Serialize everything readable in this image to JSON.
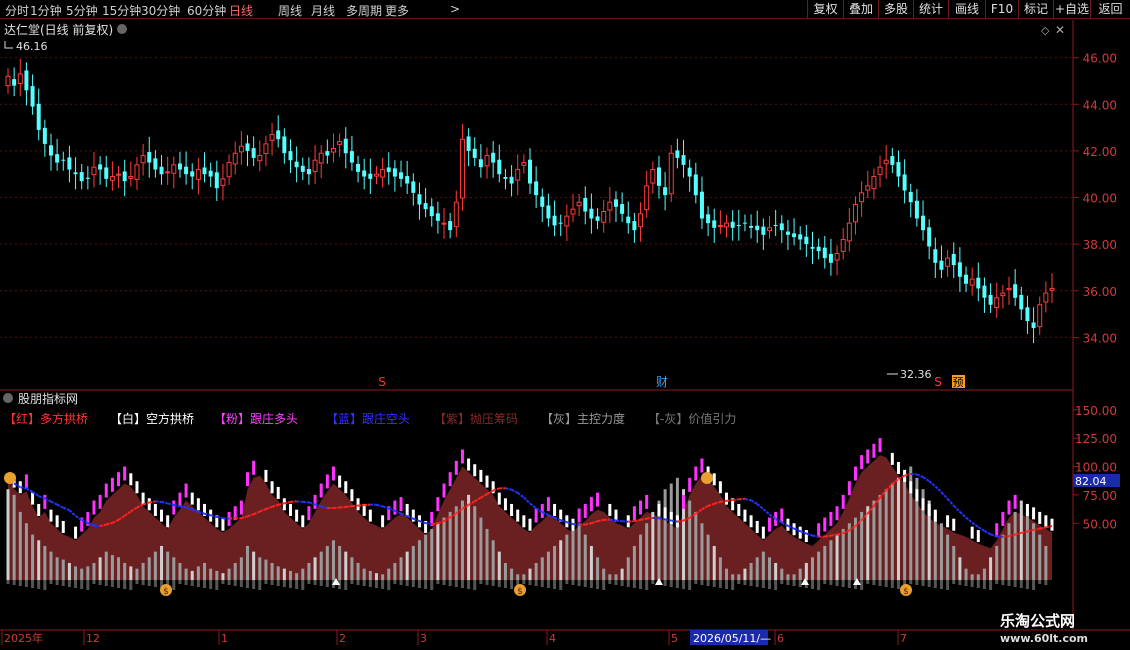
{
  "toolbar": {
    "periods": [
      "分时",
      "1分钟",
      "5分钟",
      "15分钟",
      "30分钟",
      "60分钟",
      "日线",
      "周线",
      "月线",
      "多周期",
      "更多"
    ],
    "active": "日线",
    "more_arrow": ">",
    "right_buttons": [
      "复权",
      "叠加",
      "多股",
      "统计",
      "画线",
      "F10",
      "标记",
      "+自选",
      "返回"
    ]
  },
  "main": {
    "title": "达仁堂(日线 前复权)",
    "high_label": "46.16",
    "low_label": "32.36",
    "markers": [
      {
        "text": "S",
        "color": "#ff3333"
      },
      {
        "text": "财",
        "color": "#3aa0ff"
      },
      {
        "text": "S",
        "color": "#ff3333"
      },
      {
        "text": "预",
        "color": "#ffbb33"
      }
    ]
  },
  "indicator": {
    "title": "股朋指标网",
    "current_value": "82.04",
    "legend": [
      {
        "text": "【红】多方拱桥",
        "color": "#ff3333"
      },
      {
        "text": "【白】空方拱桥",
        "color": "#ffffff"
      },
      {
        "text": "【粉】跟庄多头",
        "color": "#ff44ff"
      },
      {
        "text": "【蓝】跟庄空头",
        "color": "#3333ff"
      },
      {
        "text": "【紫】抛压筹码",
        "color": "#8a2a2a"
      },
      {
        "text": "【灰】主控力度",
        "color": "#9a9a9a"
      },
      {
        "text": "【-灰】价值引力",
        "color": "#777777"
      }
    ]
  },
  "timeline": {
    "labels": [
      "2025年",
      "12",
      "1",
      "2",
      "3",
      "4",
      "5",
      "6",
      "7"
    ],
    "cursor_date": "2026/05/11/—"
  },
  "watermark": {
    "text": "乐淘公式网",
    "url": "www.60lt.com"
  },
  "chart_data": [
    {
      "type": "candlestick",
      "title": "达仁堂(日线 前复权)",
      "yticks": [
        34.0,
        36.0,
        38.0,
        40.0,
        42.0,
        44.0,
        46.0
      ],
      "ylim": [
        32.0,
        46.8
      ],
      "grid": true,
      "n": 170,
      "close": [
        45.2,
        44.8,
        45.3,
        44.6,
        43.9,
        42.9,
        42.3,
        41.8,
        41.5,
        41.6,
        41.2,
        41.0,
        40.7,
        40.8,
        41.3,
        41.2,
        40.8,
        40.9,
        41.0,
        40.7,
        40.9,
        41.4,
        41.8,
        41.5,
        41.2,
        41.0,
        41.1,
        41.4,
        41.2,
        41.0,
        40.9,
        41.2,
        41.0,
        40.9,
        40.4,
        40.8,
        41.5,
        41.9,
        42.2,
        42.0,
        41.7,
        41.8,
        42.3,
        42.7,
        42.5,
        41.9,
        41.6,
        41.3,
        41.1,
        41.0,
        41.6,
        41.9,
        41.8,
        42.1,
        42.4,
        41.9,
        41.5,
        41.1,
        40.9,
        40.8,
        41.0,
        41.2,
        41.1,
        40.9,
        40.8,
        40.6,
        40.2,
        39.7,
        39.5,
        39.2,
        39.0,
        38.9,
        38.6,
        39.8,
        42.5,
        42.0,
        41.7,
        41.3,
        41.8,
        41.5,
        41.0,
        40.8,
        40.6,
        41.2,
        41.5,
        40.6,
        40.1,
        39.6,
        39.1,
        38.8,
        38.9,
        39.2,
        39.5,
        39.8,
        39.4,
        39.1,
        39.0,
        39.4,
        39.8,
        39.6,
        39.3,
        38.9,
        38.6,
        39.3,
        40.5,
        41.2,
        40.5,
        40.1,
        41.9,
        41.7,
        41.4,
        40.9,
        40.1,
        39.1,
        38.9,
        38.7,
        38.8,
        38.9,
        38.7,
        38.8,
        38.9,
        38.7,
        38.6,
        38.4,
        38.7,
        38.8,
        38.6,
        38.4,
        38.3,
        38.2,
        38.0,
        37.8,
        37.7,
        37.4,
        37.2,
        37.6,
        38.2,
        38.9,
        39.7,
        40.2,
        40.5,
        40.9,
        41.3,
        41.6,
        41.4,
        40.9,
        40.3,
        39.8,
        39.1,
        38.6,
        37.9,
        37.2,
        36.9,
        37.4,
        37.1,
        36.6,
        36.3,
        36.5,
        36.1,
        35.7,
        35.4,
        35.7,
        35.9,
        36.1,
        35.7,
        35.2,
        34.7,
        34.4,
        35.4,
        35.9,
        36.1
      ],
      "open_offsets": [
        0.4,
        -0.4,
        0.3,
        0.5,
        0.6,
        0.4,
        0.3,
        -0.2,
        0.2,
        0.4
      ],
      "extremes": {
        "high": 46.16,
        "low": 32.36
      }
    },
    {
      "type": "indicator",
      "title": "股朋指标网",
      "yticks": [
        50.0,
        75.0,
        100.0,
        125.0,
        150.0
      ],
      "ylim": [
        -15,
        175
      ],
      "last_value": 82.04,
      "series": [
        {
          "name": "多方拱桥",
          "color": "#ff2222"
        },
        {
          "name": "空方拱桥",
          "color": "#ffffff"
        },
        {
          "name": "跟庄多头",
          "color": "#ff33ff"
        },
        {
          "name": "跟庄空头",
          "color": "#2222ff"
        },
        {
          "name": "抛压筹码",
          "color": "#7a2424"
        },
        {
          "name": "主控力度",
          "color": "#a0a0a0"
        },
        {
          "name": "价值引力",
          "color": "#6e6e6e"
        }
      ],
      "pressure_values": [
        90,
        80,
        75,
        78,
        65,
        55,
        60,
        50,
        45,
        40,
        38,
        35,
        40,
        45,
        55,
        60,
        70,
        75,
        80,
        85,
        82,
        75,
        65,
        60,
        55,
        50,
        45,
        55,
        62,
        70,
        65,
        60,
        55,
        50,
        45,
        42,
        45,
        50,
        55,
        80,
        90,
        92,
        85,
        75,
        70,
        60,
        55,
        50,
        45,
        50,
        60,
        70,
        78,
        85,
        80,
        75,
        68,
        60,
        55,
        50,
        48,
        45,
        50,
        55,
        58,
        55,
        50,
        45,
        40,
        45,
        58,
        70,
        80,
        90,
        100,
        95,
        90,
        85,
        80,
        75,
        65,
        60,
        55,
        50,
        45,
        42,
        48,
        52,
        58,
        55,
        50,
        45,
        42,
        48,
        52,
        58,
        62,
        60,
        55,
        50,
        48,
        45,
        50,
        55,
        60,
        58,
        55,
        52,
        48,
        45,
        60,
        75,
        85,
        92,
        88,
        82,
        75,
        65,
        60,
        55,
        50,
        45,
        40,
        35,
        40,
        45,
        48,
        42,
        38,
        35,
        32,
        30,
        35,
        40,
        45,
        50,
        60,
        72,
        85,
        95,
        100,
        105,
        110,
        108,
        100,
        92,
        85,
        75,
        68,
        60,
        55,
        50,
        48,
        45,
        42,
        40,
        38,
        35,
        32,
        30,
        28,
        35,
        45,
        55,
        60,
        58,
        55,
        52,
        48,
        45,
        42
      ],
      "bar_values": [
        80,
        75,
        60,
        50,
        40,
        35,
        30,
        25,
        20,
        18,
        15,
        12,
        10,
        12,
        15,
        20,
        25,
        22,
        20,
        15,
        12,
        10,
        15,
        20,
        25,
        30,
        25,
        20,
        15,
        10,
        8,
        12,
        15,
        10,
        8,
        6,
        10,
        15,
        20,
        30,
        25,
        20,
        18,
        15,
        12,
        10,
        8,
        6,
        10,
        15,
        20,
        25,
        30,
        35,
        30,
        25,
        20,
        15,
        10,
        8,
        6,
        5,
        10,
        15,
        20,
        25,
        30,
        35,
        40,
        45,
        50,
        55,
        60,
        65,
        70,
        75,
        65,
        55,
        45,
        35,
        25,
        15,
        10,
        5,
        5,
        10,
        15,
        20,
        25,
        30,
        35,
        40,
        45,
        50,
        40,
        30,
        20,
        10,
        5,
        5,
        10,
        20,
        30,
        40,
        50,
        60,
        70,
        80,
        85,
        90,
        80,
        70,
        60,
        50,
        40,
        30,
        20,
        10,
        5,
        5,
        10,
        15,
        20,
        25,
        20,
        15,
        10,
        5,
        5,
        10,
        15,
        20,
        25,
        30,
        35,
        40,
        45,
        50,
        55,
        60,
        65,
        70,
        75,
        80,
        85,
        90,
        95,
        100,
        90,
        80,
        70,
        60,
        50,
        40,
        30,
        20,
        10,
        5,
        5,
        10,
        20,
        30,
        40,
        50,
        60,
        70,
        60,
        50,
        40,
        30
      ]
    }
  ]
}
